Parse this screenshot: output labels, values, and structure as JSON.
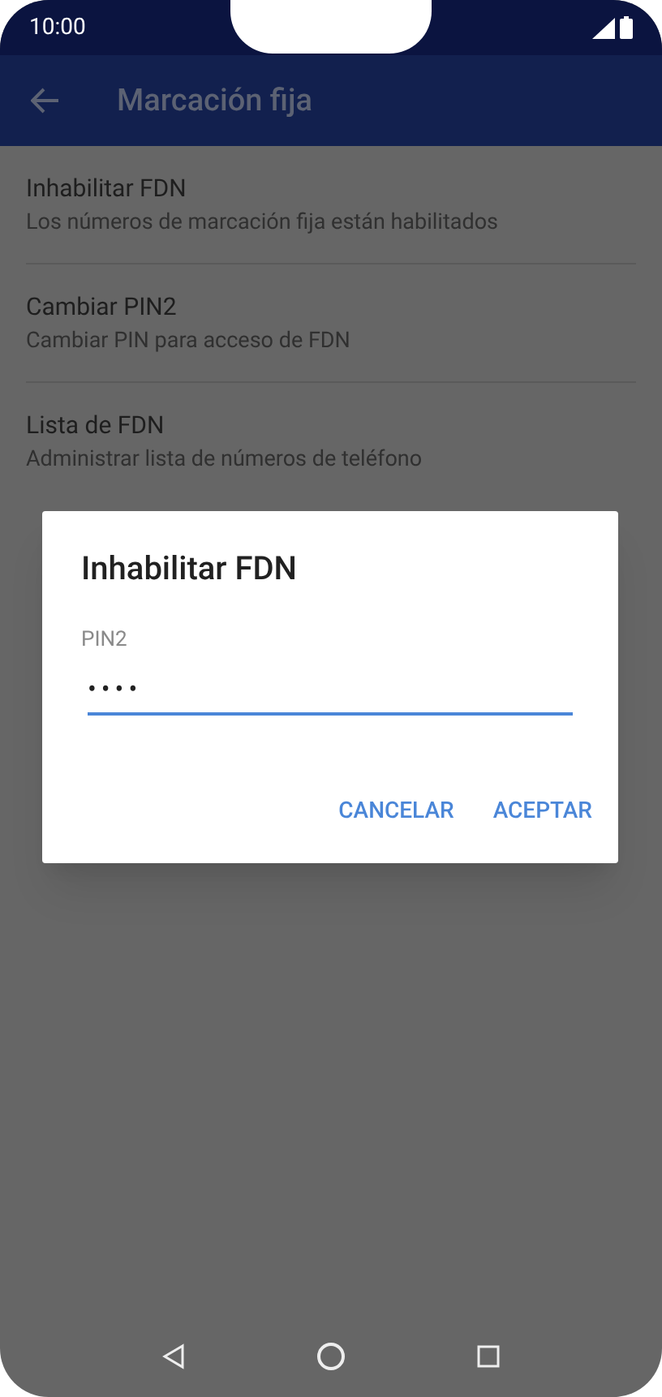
{
  "status_bar": {
    "time": "10:00"
  },
  "app_bar": {
    "title": "Marcación fija"
  },
  "settings": [
    {
      "title": "Inhabilitar FDN",
      "subtitle": "Los números de marcación fija están habilitados"
    },
    {
      "title": "Cambiar PIN2",
      "subtitle": "Cambiar PIN para acceso de FDN"
    },
    {
      "title": "Lista de FDN",
      "subtitle": "Administrar lista de números de teléfono"
    }
  ],
  "dialog": {
    "title": "Inhabilitar FDN",
    "field": {
      "label": "PIN2",
      "value": "••••"
    },
    "buttons": [
      "CANCELAR",
      "ACEPTAR"
    ]
  }
}
